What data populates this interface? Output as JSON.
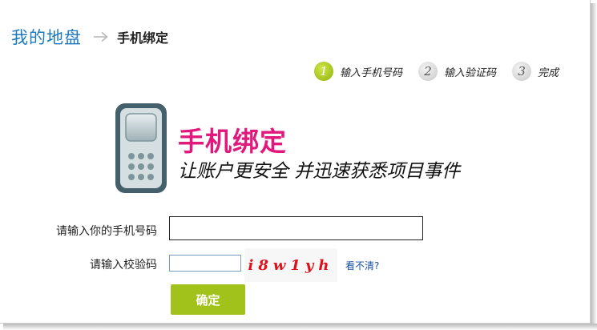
{
  "breadcrumb": {
    "home": "我的地盘",
    "current": "手机绑定"
  },
  "steps": [
    {
      "num": "1",
      "label": "输入手机号码",
      "active": true
    },
    {
      "num": "2",
      "label": "输入验证码",
      "active": false
    },
    {
      "num": "3",
      "label": "完成",
      "active": false
    }
  ],
  "hero": {
    "title": "手机绑定",
    "subtitle": "让账户更安全 并迅速获悉项目事件"
  },
  "form": {
    "phone_label": "请输入你的手机号码",
    "phone_value": "",
    "code_label": "请输入校验码",
    "code_value": "",
    "captcha_text": "i8w1yh",
    "refresh_link": "看不清?",
    "submit_label": "确定"
  },
  "colors": {
    "brand_blue": "#1c79c0",
    "accent_pink": "#e1197c",
    "button_green": "#a1c21a",
    "captcha_red": "#e0101a"
  },
  "icons": {
    "breadcrumb_separator": "arrow-right-icon",
    "hero": "mobile-phone-icon"
  }
}
